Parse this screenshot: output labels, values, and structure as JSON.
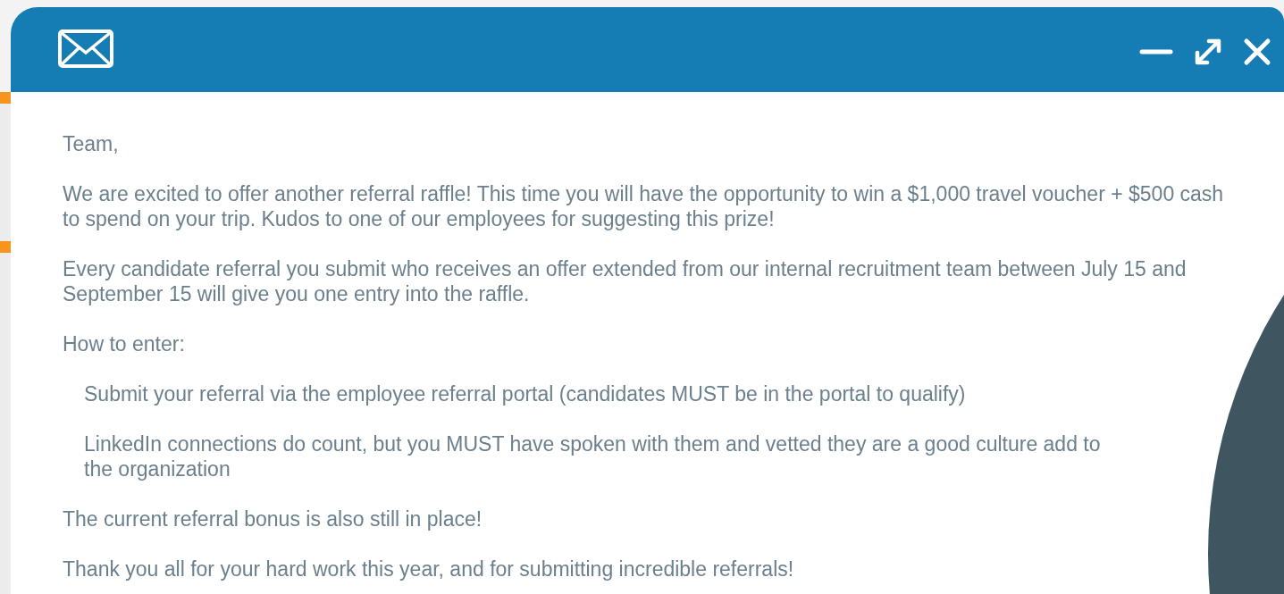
{
  "message": {
    "paragraphs": [
      {
        "kind": "text",
        "text": "Team,"
      },
      {
        "kind": "text",
        "text": "We are excited to offer another referral raffle! This time you will have the opportunity to win a $1,000 travel voucher + $500 cash to spend on your trip. Kudos to one of our employees for suggesting this prize!"
      },
      {
        "kind": "text",
        "text": "Every candidate referral you submit who receives an offer extended from our internal recruitment team between July 15 and September 15 will give you one entry into the raffle."
      },
      {
        "kind": "text",
        "text": "How to enter:"
      },
      {
        "kind": "bullet",
        "text": "Submit your referral via the employee referral portal (candidates MUST be in the portal to qualify)"
      },
      {
        "kind": "bullet",
        "text": "LinkedIn connections do count, but you MUST have spoken with them and vetted they are a good culture add to the organization"
      },
      {
        "kind": "text",
        "text": "The current referral bonus is also still in place!"
      },
      {
        "kind": "text",
        "text": "Thank you all for your hard work this year, and for submitting incredible referrals!"
      }
    ]
  }
}
